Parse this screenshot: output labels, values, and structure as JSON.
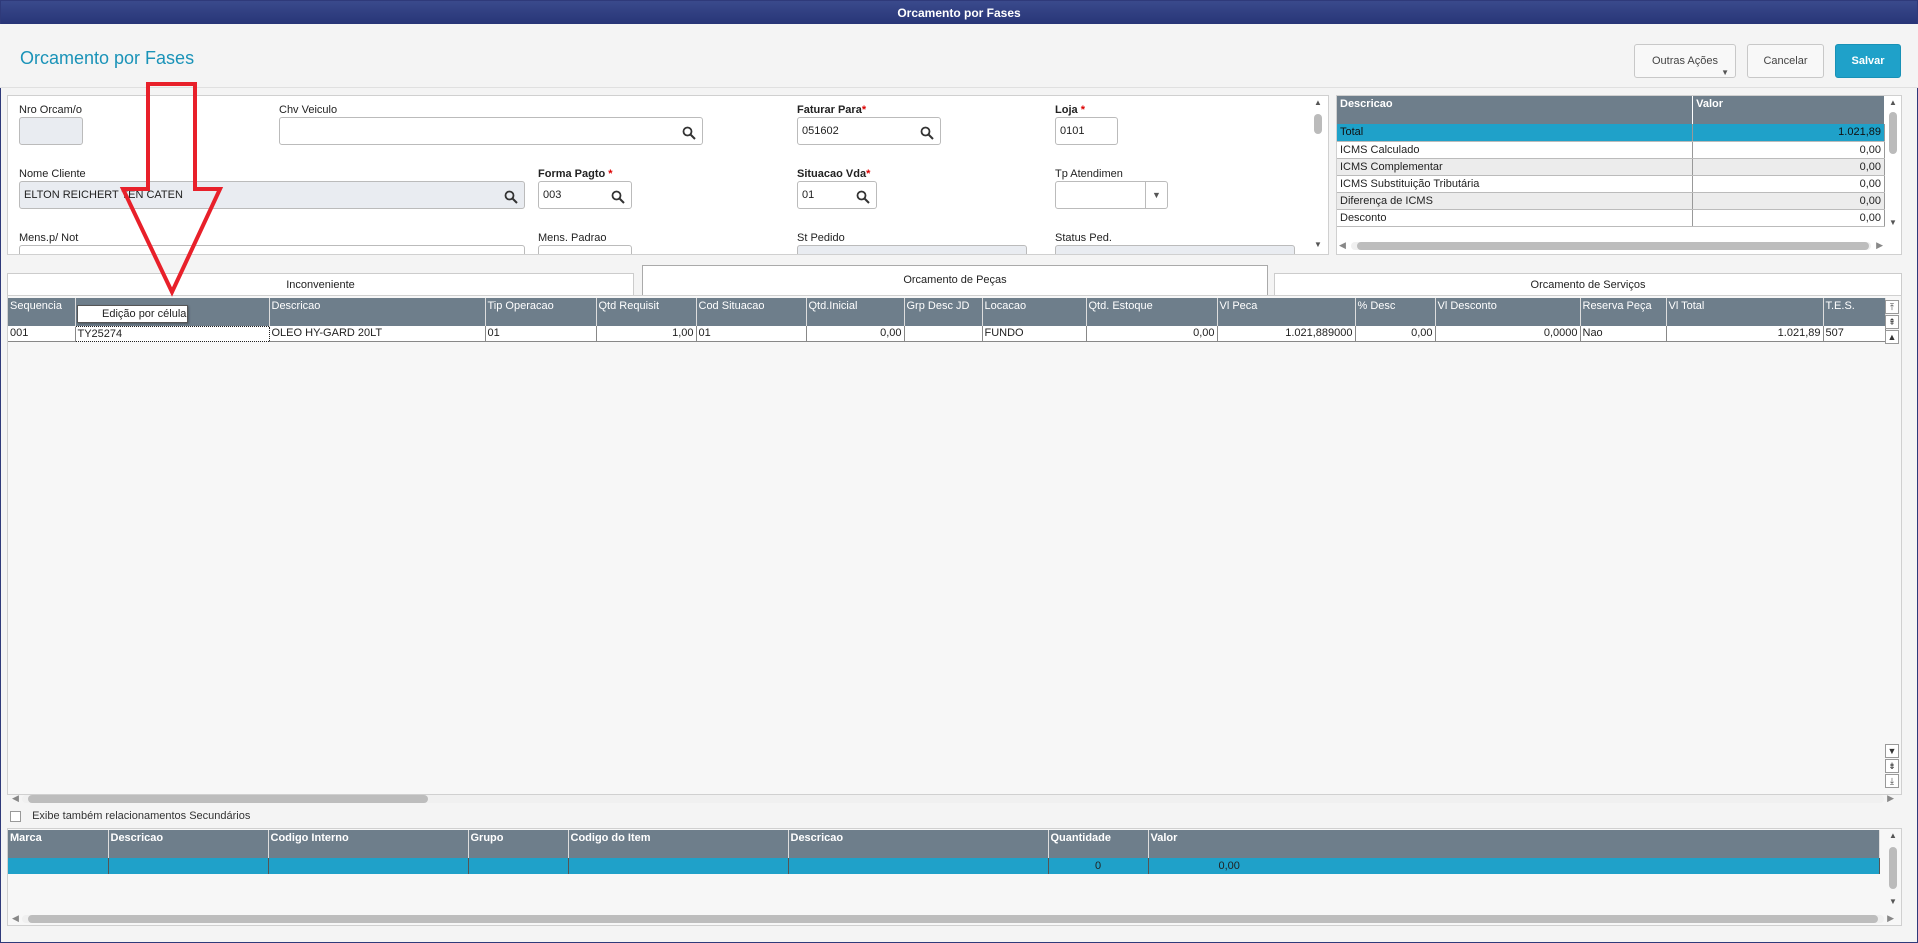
{
  "window": {
    "title": "Orcamento por Fases"
  },
  "header": {
    "title": "Orcamento por Fases",
    "buttons": {
      "other_actions": "Outras Ações",
      "cancel": "Cancelar",
      "save": "Salvar"
    }
  },
  "form": {
    "nro_orcamento": {
      "label": "Nro Orcam/o",
      "value": ""
    },
    "chv_veiculo": {
      "label": "Chv Veiculo",
      "value": ""
    },
    "faturar_para": {
      "label": "Faturar Para",
      "value": "051602"
    },
    "loja": {
      "label": "Loja",
      "value": "0101"
    },
    "nome_cliente": {
      "label": "Nome Cliente",
      "value": "ELTON REICHERT TEN CATEN"
    },
    "forma_pagto": {
      "label": "Forma Pagto",
      "value": "003"
    },
    "situacao_vda": {
      "label": "Situacao Vda",
      "value": "01"
    },
    "tp_atendimen": {
      "label": "Tp Atendimen",
      "value": ""
    },
    "mens_not": {
      "label": "Mens.p/ Not"
    },
    "mens_padrao": {
      "label": "Mens. Padrao"
    },
    "st_pedido": {
      "label": "St Pedido"
    },
    "status_ped": {
      "label": "Status Ped."
    },
    "required_mark": "*"
  },
  "totals": {
    "headers": [
      "Descricao",
      "Valor"
    ],
    "rows": [
      {
        "desc": "Total",
        "value": "1.021,89"
      },
      {
        "desc": "ICMS Calculado",
        "value": "0,00"
      },
      {
        "desc": "ICMS Complementar",
        "value": "0,00"
      },
      {
        "desc": "ICMS Substituição Tributária",
        "value": "0,00"
      },
      {
        "desc": "Diferença de ICMS",
        "value": "0,00"
      },
      {
        "desc": "Desconto",
        "value": "0,00"
      }
    ]
  },
  "tabs": [
    "Inconveniente",
    "Orcamento de Peças",
    "Orcamento de Serviços"
  ],
  "grid": {
    "headers": [
      "Sequencia",
      "",
      "Descricao",
      "Tip Operacao",
      "Qtd Requisit",
      "Cod Situacao",
      "Qtd.Inicial",
      "Grp Desc JD",
      "Locacao",
      "Qtd. Estoque",
      "Vl Peca",
      "% Desc",
      "Vl Desconto",
      "Reserva Peça",
      "Vl Total",
      "T.E.S."
    ],
    "row": [
      "001",
      "TY25274",
      "OLEO HY-GARD 20LT",
      "01",
      "1,00",
      "01",
      "0,00",
      "",
      "FUNDO",
      "0,00",
      "1.021,889000",
      "0,00",
      "0,0000",
      "Nao",
      "1.021,89",
      "507"
    ],
    "tooltip": "Edição por célula"
  },
  "secondary": {
    "label": "Exibe também relacionamentos Secundários"
  },
  "bottom_grid": {
    "headers": [
      "Marca",
      "Descricao",
      "Codigo Interno",
      "Grupo",
      "Codigo do Item",
      "Descricao",
      "Quantidade",
      "Valor"
    ],
    "row": [
      "",
      "",
      "",
      "",
      "",
      "",
      "0",
      "0,00"
    ]
  },
  "colors": {
    "accent": "#1fa1c9",
    "header_bg": "#6e7e8b",
    "title_bar": "#273476",
    "annotation": "#e8202a"
  }
}
